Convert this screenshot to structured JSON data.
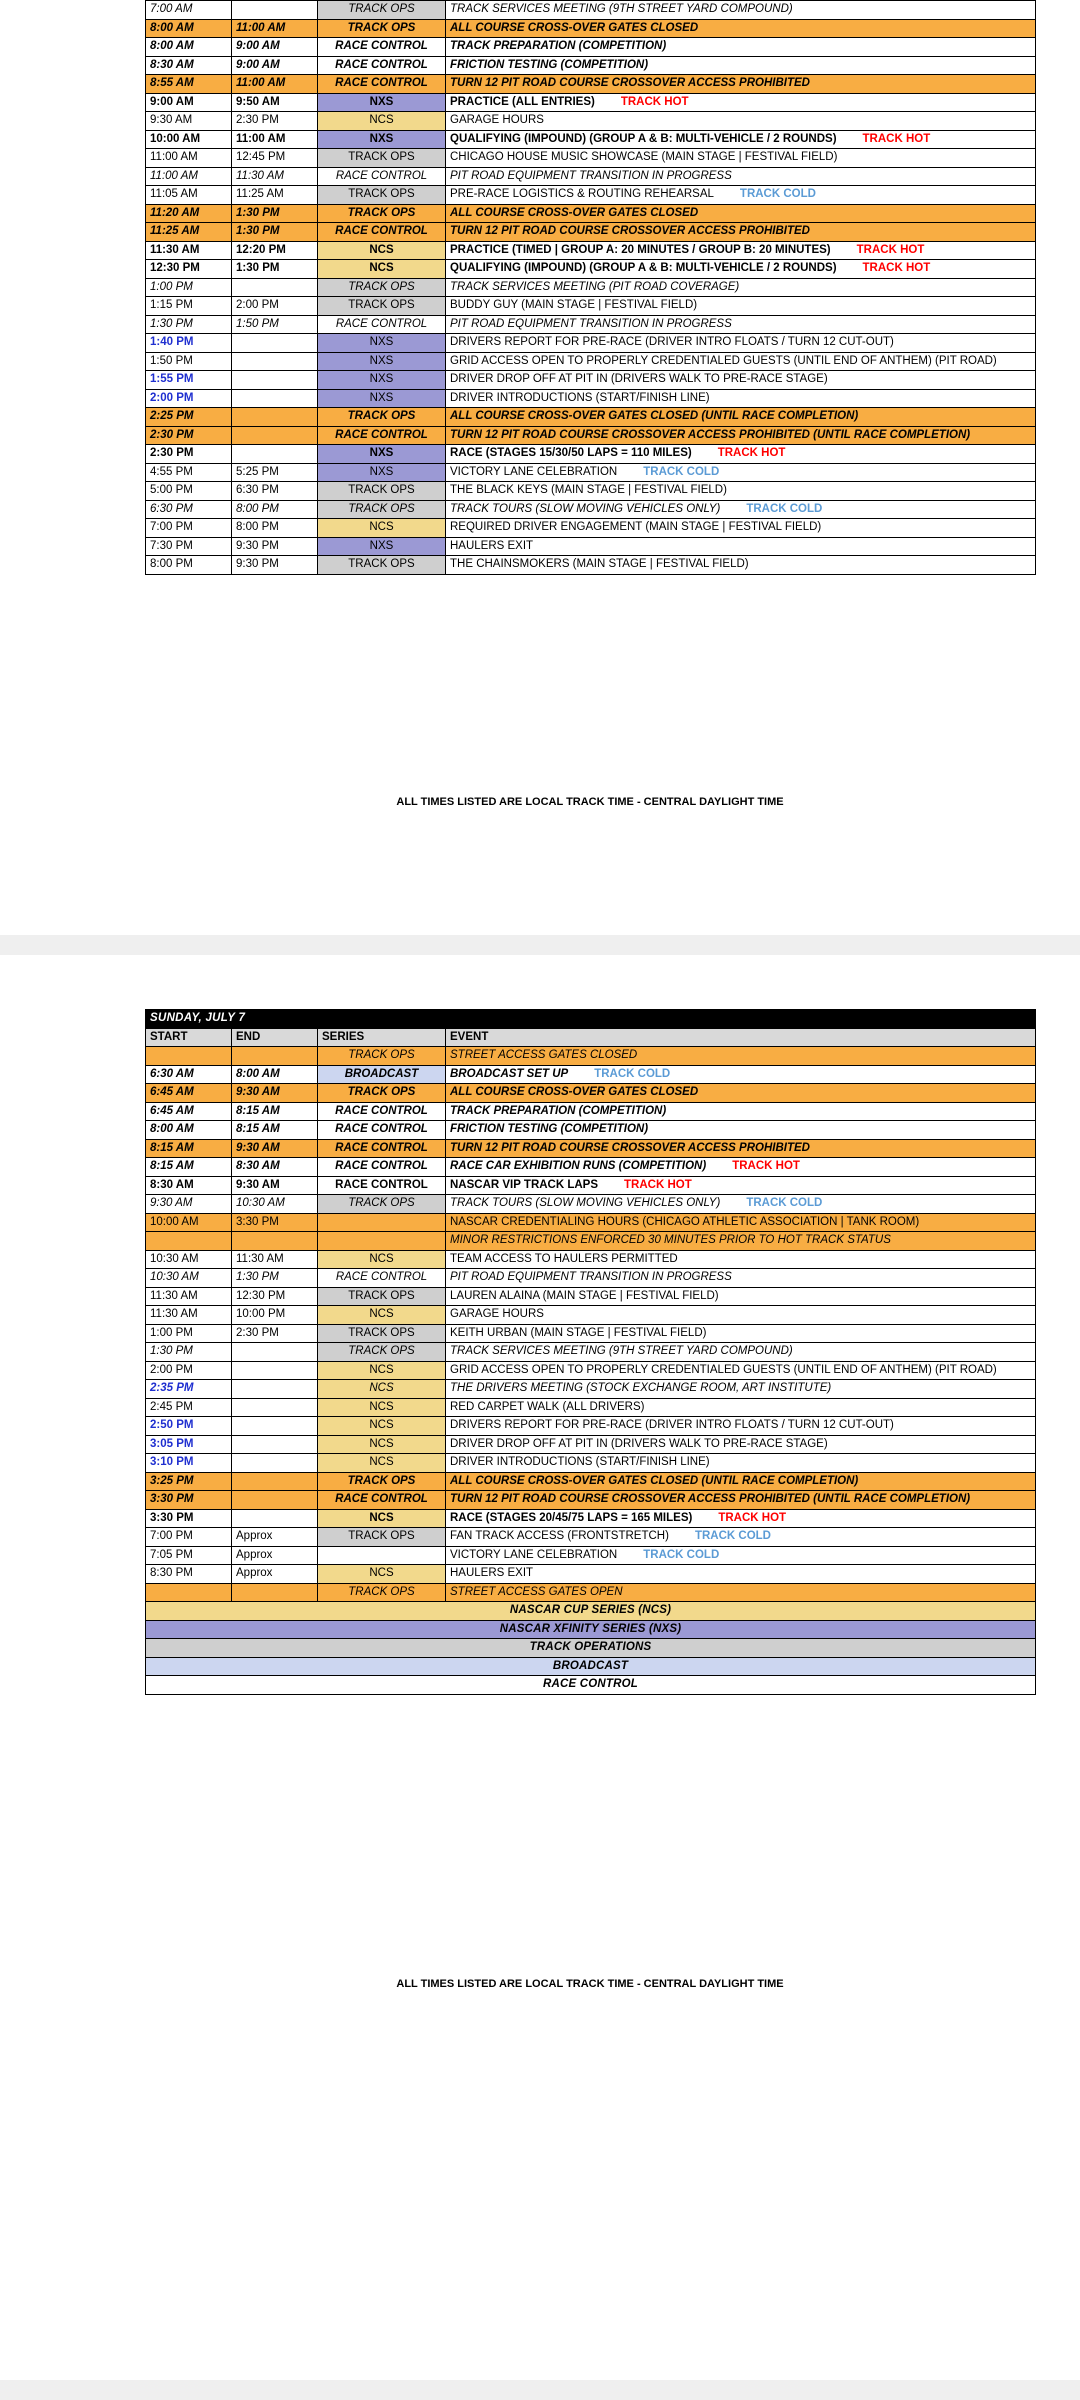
{
  "columns": {
    "start": "START",
    "end": "END",
    "series": "SERIES",
    "event": "EVENT"
  },
  "footnote": "ALL TIMES LISTED ARE LOCAL TRACK TIME - CENTRAL DAYLIGHT TIME",
  "colors": {
    "ncs": "#f2d98c",
    "nxs": "#9b99d4",
    "track_ops": "#cfcfcf",
    "broadcast": "#ccd6f0",
    "race_control": "#ffffff",
    "highlight_orange": "#f8ad43",
    "day_header": "#000000",
    "column_header": "#d9d9d9",
    "track_hot": "#ff0000",
    "track_cold": "#5b9bd5",
    "blue_time": "#1f2fd0"
  },
  "saturday": {
    "rows": [
      {
        "start": "7:00 AM",
        "end": "",
        "series": "TRACK OPS",
        "event": "TRACK SERVICES MEETING (9TH STREET YARD COMPOUND)",
        "status": "",
        "series_style": "ops",
        "text_style": "i",
        "row_highlight": false,
        "time_blue": false
      },
      {
        "start": "8:00 AM",
        "end": "11:00 AM",
        "series": "TRACK OPS",
        "event": "ALL COURSE CROSS-OVER GATES CLOSED",
        "status": "",
        "series_style": "ops",
        "text_style": "bi",
        "row_highlight": true,
        "time_blue": false
      },
      {
        "start": "8:00 AM",
        "end": "9:00 AM",
        "series": "RACE CONTROL",
        "event": "TRACK PREPARATION  (COMPETITION)",
        "status": "",
        "series_style": "rc",
        "text_style": "bi",
        "row_highlight": false,
        "time_blue": false
      },
      {
        "start": "8:30 AM",
        "end": "9:00 AM",
        "series": "RACE CONTROL",
        "event": "FRICTION TESTING  (COMPETITION)",
        "status": "",
        "series_style": "rc",
        "text_style": "bi",
        "row_highlight": false,
        "time_blue": false
      },
      {
        "start": "8:55 AM",
        "end": "11:00 AM",
        "series": "RACE CONTROL",
        "event": "TURN 12 PIT ROAD COURSE CROSSOVER ACCESS PROHIBITED",
        "status": "",
        "series_style": "rc",
        "text_style": "bi",
        "row_highlight": true,
        "time_blue": false
      },
      {
        "start": "9:00 AM",
        "end": "9:50 AM",
        "series": "NXS",
        "event": "PRACTICE (ALL ENTRIES)",
        "status": "TRACK HOT",
        "series_style": "nxs",
        "text_style": "b",
        "row_highlight": false,
        "time_blue": false
      },
      {
        "start": "9:30 AM",
        "end": "2:30 PM",
        "series": "NCS",
        "event": "GARAGE HOURS",
        "status": "",
        "series_style": "ncs",
        "text_style": "",
        "row_highlight": false,
        "time_blue": false
      },
      {
        "start": "10:00 AM",
        "end": "11:00 AM",
        "series": "NXS",
        "event": "QUALIFYING (IMPOUND) (GROUP A & B: MULTI-VEHICLE / 2 ROUNDS)",
        "status": "TRACK HOT",
        "series_style": "nxs",
        "text_style": "b",
        "row_highlight": false,
        "time_blue": false
      },
      {
        "start": "11:00 AM",
        "end": "12:45 PM",
        "series": "TRACK OPS",
        "event": "CHICAGO HOUSE MUSIC SHOWCASE (MAIN STAGE | FESTIVAL FIELD)",
        "status": "",
        "series_style": "ops",
        "text_style": "",
        "row_highlight": false,
        "time_blue": false
      },
      {
        "start": "11:00 AM",
        "end": "11:30 AM",
        "series": "RACE CONTROL",
        "event": "PIT ROAD EQUIPMENT TRANSITION IN PROGRESS",
        "status": "",
        "series_style": "rc",
        "text_style": "i",
        "row_highlight": false,
        "time_blue": false
      },
      {
        "start": "11:05 AM",
        "end": "11:25 AM",
        "series": "TRACK OPS",
        "event": "PRE-RACE LOGISTICS & ROUTING REHEARSAL",
        "status": "TRACK COLD",
        "series_style": "ops",
        "text_style": "",
        "row_highlight": false,
        "time_blue": false
      },
      {
        "start": "11:20 AM",
        "end": "1:30 PM",
        "series": "TRACK OPS",
        "event": "ALL COURSE CROSS-OVER GATES CLOSED",
        "status": "",
        "series_style": "ops",
        "text_style": "bi",
        "row_highlight": true,
        "time_blue": false
      },
      {
        "start": "11:25 AM",
        "end": "1:30 PM",
        "series": "RACE CONTROL",
        "event": "TURN 12 PIT ROAD COURSE CROSSOVER ACCESS PROHIBITED",
        "status": "",
        "series_style": "rc",
        "text_style": "bi",
        "row_highlight": true,
        "time_blue": false
      },
      {
        "start": "11:30 AM",
        "end": "12:20 PM",
        "series": "NCS",
        "event": "PRACTICE (TIMED | GROUP A: 20 MINUTES / GROUP B: 20 MINUTES)",
        "status": "TRACK HOT",
        "series_style": "ncs",
        "text_style": "b",
        "row_highlight": false,
        "time_blue": false
      },
      {
        "start": "12:30 PM",
        "end": "1:30 PM",
        "series": "NCS",
        "event": "QUALIFYING (IMPOUND) (GROUP A & B: MULTI-VEHICLE / 2 ROUNDS)",
        "status": "TRACK HOT",
        "series_style": "ncs",
        "text_style": "b",
        "row_highlight": false,
        "time_blue": false
      },
      {
        "start": "1:00 PM",
        "end": "",
        "series": "TRACK OPS",
        "event": "TRACK SERVICES MEETING (PIT ROAD COVERAGE)",
        "status": "",
        "series_style": "ops",
        "text_style": "i",
        "row_highlight": false,
        "time_blue": false
      },
      {
        "start": "1:15 PM",
        "end": "2:00 PM",
        "series": "TRACK OPS",
        "event": "BUDDY GUY (MAIN STAGE | FESTIVAL FIELD)",
        "status": "",
        "series_style": "ops",
        "text_style": "",
        "row_highlight": false,
        "time_blue": false
      },
      {
        "start": "1:30 PM",
        "end": "1:50 PM",
        "series": "RACE CONTROL",
        "event": "PIT ROAD EQUIPMENT TRANSITION IN PROGRESS",
        "status": "",
        "series_style": "rc",
        "text_style": "i",
        "row_highlight": false,
        "time_blue": false
      },
      {
        "start": "1:40 PM",
        "end": "",
        "series": "NXS",
        "event": "DRIVERS REPORT FOR PRE-RACE (DRIVER INTRO FLOATS / TURN 12 CUT-OUT)",
        "status": "",
        "series_style": "nxs",
        "text_style": "",
        "row_highlight": false,
        "time_blue": true
      },
      {
        "start": "1:50 PM",
        "end": "",
        "series": "NXS",
        "event": "GRID ACCESS OPEN TO PROPERLY CREDENTIALED GUESTS (UNTIL END OF ANTHEM) (PIT ROAD)",
        "status": "",
        "series_style": "nxs",
        "text_style": "",
        "row_highlight": false,
        "time_blue": false
      },
      {
        "start": "1:55 PM",
        "end": "",
        "series": "NXS",
        "event": "DRIVER DROP OFF AT PIT IN (DRIVERS WALK TO PRE-RACE STAGE)",
        "status": "",
        "series_style": "nxs",
        "text_style": "",
        "row_highlight": false,
        "time_blue": true
      },
      {
        "start": "2:00 PM",
        "end": "",
        "series": "NXS",
        "event": "DRIVER INTRODUCTIONS (START/FINISH LINE)",
        "status": "",
        "series_style": "nxs",
        "text_style": "",
        "row_highlight": false,
        "time_blue": true
      },
      {
        "start": "2:25 PM",
        "end": "",
        "series": "TRACK OPS",
        "event": "ALL COURSE CROSS-OVER GATES CLOSED (UNTIL RACE COMPLETION)",
        "status": "",
        "series_style": "ops",
        "text_style": "bi",
        "row_highlight": true,
        "time_blue": false
      },
      {
        "start": "2:30 PM",
        "end": "",
        "series": "RACE CONTROL",
        "event": "TURN 12 PIT ROAD COURSE CROSSOVER ACCESS PROHIBITED (UNTIL RACE COMPLETION)",
        "status": "",
        "series_style": "rc",
        "text_style": "bi",
        "row_highlight": true,
        "time_blue": false
      },
      {
        "start": "2:30 PM",
        "end": "",
        "series": "NXS",
        "event": "RACE (STAGES 15/30/50 LAPS = 110 MILES)",
        "status": "TRACK HOT",
        "series_style": "nxs",
        "text_style": "b",
        "row_highlight": false,
        "time_blue": false
      },
      {
        "start": "4:55 PM",
        "end": "5:25 PM",
        "series": "NXS",
        "event": "VICTORY LANE CELEBRATION",
        "status": "TRACK COLD",
        "series_style": "nxs",
        "text_style": "",
        "row_highlight": false,
        "time_blue": false
      },
      {
        "start": "5:00 PM",
        "end": "6:30 PM",
        "series": "TRACK OPS",
        "event": "THE BLACK KEYS (MAIN STAGE | FESTIVAL FIELD)",
        "status": "",
        "series_style": "ops",
        "text_style": "",
        "row_highlight": false,
        "time_blue": false
      },
      {
        "start": "6:30 PM",
        "end": "8:00 PM",
        "series": "TRACK OPS",
        "event": "TRACK TOURS (SLOW MOVING VEHICLES ONLY)",
        "status": "TRACK COLD",
        "series_style": "ops",
        "text_style": "i",
        "row_highlight": false,
        "time_blue": false
      },
      {
        "start": "7:00 PM",
        "end": "8:00 PM",
        "series": "NCS",
        "event": "REQUIRED DRIVER ENGAGEMENT (MAIN STAGE | FESTIVAL FIELD)",
        "status": "",
        "series_style": "ncs",
        "text_style": "",
        "row_highlight": false,
        "time_blue": false
      },
      {
        "start": "7:30 PM",
        "end": "9:30 PM",
        "series": "NXS",
        "event": "HAULERS EXIT",
        "status": "",
        "series_style": "nxs",
        "text_style": "",
        "row_highlight": false,
        "time_blue": false
      },
      {
        "start": "8:00 PM",
        "end": "9:30 PM",
        "series": "TRACK OPS",
        "event": "THE CHAINSMOKERS (MAIN STAGE | FESTIVAL FIELD)",
        "status": "",
        "series_style": "ops",
        "text_style": "",
        "row_highlight": false,
        "time_blue": false
      }
    ]
  },
  "sunday": {
    "day_title": "SUNDAY, JULY 7",
    "rows": [
      {
        "start": "",
        "end": "",
        "series": "TRACK OPS",
        "event": "STREET ACCESS GATES CLOSED",
        "status": "",
        "series_style": "ops",
        "text_style": "i",
        "row_highlight": true,
        "time_blue": false
      },
      {
        "start": "6:30 AM",
        "end": "8:00 AM",
        "series": "BROADCAST",
        "event": "BROADCAST SET UP",
        "status": "TRACK COLD",
        "series_style": "broadcast",
        "text_style": "bi",
        "row_highlight": false,
        "time_blue": false
      },
      {
        "start": "6:45 AM",
        "end": "9:30 AM",
        "series": "TRACK OPS",
        "event": "ALL COURSE CROSS-OVER GATES CLOSED",
        "status": "",
        "series_style": "ops",
        "text_style": "bi",
        "row_highlight": true,
        "time_blue": false
      },
      {
        "start": "6:45 AM",
        "end": "8:15 AM",
        "series": "RACE CONTROL",
        "event": "TRACK PREPARATION  (COMPETITION)",
        "status": "",
        "series_style": "rc",
        "text_style": "bi",
        "row_highlight": false,
        "time_blue": false
      },
      {
        "start": "8:00 AM",
        "end": "8:15 AM",
        "series": "RACE CONTROL",
        "event": "FRICTION TESTING  (COMPETITION)",
        "status": "",
        "series_style": "rc",
        "text_style": "bi",
        "row_highlight": false,
        "time_blue": false
      },
      {
        "start": "8:15 AM",
        "end": "9:30 AM",
        "series": "RACE CONTROL",
        "event": "TURN 12 PIT ROAD COURSE CROSSOVER ACCESS PROHIBITED",
        "status": "",
        "series_style": "rc",
        "text_style": "bi",
        "row_highlight": true,
        "time_blue": false
      },
      {
        "start": "8:15 AM",
        "end": "8:30 AM",
        "series": "RACE CONTROL",
        "event": "RACE CAR EXHIBITION RUNS (COMPETITION)",
        "status": "TRACK HOT",
        "series_style": "rc",
        "text_style": "bi",
        "row_highlight": false,
        "time_blue": false
      },
      {
        "start": "8:30 AM",
        "end": "9:30 AM",
        "series": "RACE CONTROL",
        "event": "NASCAR VIP TRACK LAPS",
        "status": "TRACK HOT",
        "series_style": "rc",
        "text_style": "b",
        "row_highlight": false,
        "time_blue": false
      },
      {
        "start": "9:30 AM",
        "end": "10:30 AM",
        "series": "TRACK OPS",
        "event": "TRACK TOURS (SLOW MOVING VEHICLES ONLY)",
        "status": "TRACK COLD",
        "series_style": "ops",
        "text_style": "i",
        "row_highlight": false,
        "time_blue": false
      },
      {
        "start": "10:00 AM",
        "end": "3:30 PM",
        "series": "",
        "event": "NASCAR CREDENTIALING HOURS (CHICAGO ATHLETIC ASSOCIATION | TANK ROOM)",
        "status": "",
        "series_style": "rc",
        "text_style": "",
        "row_highlight": true,
        "time_blue": false
      },
      {
        "start": "",
        "end": "",
        "series": "",
        "event": "MINOR RESTRICTIONS ENFORCED 30 MINUTES PRIOR TO HOT TRACK STATUS",
        "status": "",
        "series_style": "rc",
        "text_style": "i",
        "row_highlight": true,
        "time_blue": false
      },
      {
        "start": "10:30 AM",
        "end": "11:30 AM",
        "series": "NCS",
        "event": "TEAM ACCESS TO HAULERS PERMITTED",
        "status": "",
        "series_style": "ncs",
        "text_style": "",
        "row_highlight": false,
        "time_blue": false
      },
      {
        "start": "10:30 AM",
        "end": "1:30 PM",
        "series": "RACE CONTROL",
        "event": "PIT ROAD EQUIPMENT TRANSITION IN PROGRESS",
        "status": "",
        "series_style": "rc",
        "text_style": "i",
        "row_highlight": false,
        "time_blue": false
      },
      {
        "start": "11:30 AM",
        "end": "12:30 PM",
        "series": "TRACK OPS",
        "event": "LAUREN ALAINA (MAIN STAGE | FESTIVAL FIELD)",
        "status": "",
        "series_style": "ops",
        "text_style": "",
        "row_highlight": false,
        "time_blue": false
      },
      {
        "start": "11:30 AM",
        "end": "10:00 PM",
        "series": "NCS",
        "event": "GARAGE HOURS",
        "status": "",
        "series_style": "ncs",
        "text_style": "",
        "row_highlight": false,
        "time_blue": false
      },
      {
        "start": "1:00 PM",
        "end": "2:30 PM",
        "series": "TRACK OPS",
        "event": "KEITH URBAN (MAIN STAGE | FESTIVAL FIELD)",
        "status": "",
        "series_style": "ops",
        "text_style": "",
        "row_highlight": false,
        "time_blue": false
      },
      {
        "start": "1:30 PM",
        "end": "",
        "series": "TRACK OPS",
        "event": "TRACK SERVICES MEETING (9TH STREET YARD COMPOUND)",
        "status": "",
        "series_style": "ops",
        "text_style": "i",
        "row_highlight": false,
        "time_blue": false
      },
      {
        "start": "2:00 PM",
        "end": "",
        "series": "NCS",
        "event": "GRID ACCESS OPEN TO PROPERLY CREDENTIALED GUESTS (UNTIL END OF ANTHEM) (PIT ROAD)",
        "status": "",
        "series_style": "ncs",
        "text_style": "",
        "row_highlight": false,
        "time_blue": false
      },
      {
        "start": "2:35 PM",
        "end": "",
        "series": "NCS",
        "event": "THE DRIVERS MEETING (STOCK EXCHANGE ROOM, ART INSTITUTE)",
        "status": "",
        "series_style": "ncs",
        "text_style": "i",
        "row_highlight": false,
        "time_blue": true
      },
      {
        "start": "2:45 PM",
        "end": "",
        "series": "NCS",
        "event": "RED CARPET WALK (ALL DRIVERS)",
        "status": "",
        "series_style": "ncs",
        "text_style": "",
        "row_highlight": false,
        "time_blue": false
      },
      {
        "start": "2:50 PM",
        "end": "",
        "series": "NCS",
        "event": "DRIVERS REPORT FOR PRE-RACE (DRIVER INTRO FLOATS / TURN 12 CUT-OUT)",
        "status": "",
        "series_style": "ncs",
        "text_style": "",
        "row_highlight": false,
        "time_blue": true
      },
      {
        "start": "3:05 PM",
        "end": "",
        "series": "NCS",
        "event": "DRIVER DROP OFF AT PIT IN (DRIVERS WALK TO PRE-RACE STAGE)",
        "status": "",
        "series_style": "ncs",
        "text_style": "",
        "row_highlight": false,
        "time_blue": true
      },
      {
        "start": "3:10 PM",
        "end": "",
        "series": "NCS",
        "event": "DRIVER INTRODUCTIONS (START/FINISH LINE)",
        "status": "",
        "series_style": "ncs",
        "text_style": "",
        "row_highlight": false,
        "time_blue": true
      },
      {
        "start": "3:25 PM",
        "end": "",
        "series": "TRACK OPS",
        "event": "ALL COURSE CROSS-OVER GATES CLOSED (UNTIL RACE COMPLETION)",
        "status": "",
        "series_style": "ops",
        "text_style": "bi",
        "row_highlight": true,
        "time_blue": false
      },
      {
        "start": "3:30 PM",
        "end": "",
        "series": "RACE CONTROL",
        "event": "TURN 12 PIT ROAD COURSE CROSSOVER ACCESS PROHIBITED (UNTIL RACE COMPLETION)",
        "status": "",
        "series_style": "rc",
        "text_style": "bi",
        "row_highlight": true,
        "time_blue": false
      },
      {
        "start": "3:30 PM",
        "end": "",
        "series": "NCS",
        "event": "RACE (STAGES 20/45/75 LAPS = 165 MILES)",
        "status": "TRACK HOT",
        "series_style": "ncs",
        "text_style": "b",
        "row_highlight": false,
        "time_blue": false
      },
      {
        "start": "7:00 PM",
        "end": "Approx",
        "series": "TRACK OPS",
        "event": "FAN TRACK ACCESS (FRONTSTRETCH)",
        "status": "TRACK COLD",
        "series_style": "ops",
        "text_style": "",
        "row_highlight": false,
        "time_blue": false
      },
      {
        "start": "7:05 PM",
        "end": "Approx",
        "series": "",
        "event": "VICTORY LANE CELEBRATION",
        "status": "TRACK COLD",
        "series_style": "rc",
        "text_style": "",
        "row_highlight": false,
        "time_blue": false
      },
      {
        "start": "8:30 PM",
        "end": "Approx",
        "series": "NCS",
        "event": "HAULERS EXIT",
        "status": "",
        "series_style": "ncs",
        "text_style": "",
        "row_highlight": false,
        "time_blue": false
      },
      {
        "start": "",
        "end": "",
        "series": "TRACK OPS",
        "event": "STREET ACCESS GATES OPEN",
        "status": "",
        "series_style": "ops",
        "text_style": "i",
        "row_highlight": true,
        "time_blue": false
      }
    ],
    "legend": [
      {
        "label": "NASCAR CUP SERIES (NCS)",
        "style": "lg-ncs"
      },
      {
        "label": "NASCAR XFINITY SERIES (NXS)",
        "style": "lg-nxs"
      },
      {
        "label": "TRACK OPERATIONS",
        "style": "lg-ops"
      },
      {
        "label": "BROADCAST",
        "style": "lg-bc"
      },
      {
        "label": "RACE CONTROL",
        "style": "lg-rc"
      }
    ]
  }
}
